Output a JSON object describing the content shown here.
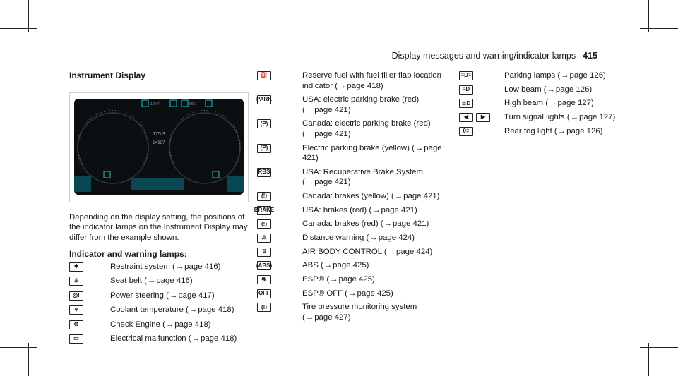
{
  "header": {
    "section": "Display messages and warning/indicator lamps",
    "page_number": "415"
  },
  "left": {
    "heading": "Instrument Display",
    "intro": "Depending on the display setting, the positions of the indicator lamps on the Instrument Display may differ from the example shown.",
    "subheading": "Indicator and warning lamps:",
    "cluster": {
      "top_left": "105°F",
      "top_right": "3:56",
      "center_top": "175.3",
      "center_bottom": "24967"
    },
    "items": [
      {
        "icon": "restraint-system-icon",
        "glyph": "✱",
        "text": "Restraint system (",
        "page": "page 416)"
      },
      {
        "icon": "seat-belt-icon",
        "glyph": "♙",
        "text": "Seat belt (",
        "page": "page 416)"
      },
      {
        "icon": "power-steering-icon",
        "glyph": "◎!",
        "text": "Power steering (",
        "page": "page 417)"
      },
      {
        "icon": "coolant-temperature-icon",
        "glyph": "⫧",
        "text": "Coolant temperature (",
        "page": "page 418)"
      },
      {
        "icon": "check-engine-icon",
        "glyph": "⚙",
        "text": "Check Engine (",
        "page": "page 418)"
      },
      {
        "icon": "battery-icon",
        "glyph": "▭",
        "text": "Electrical malfunction (",
        "page": "page 418)"
      }
    ]
  },
  "middle": {
    "items": [
      {
        "icon": "fuel-icon",
        "glyph": "⛽",
        "text": "Reserve fuel with fuel filler flap location indicator (",
        "page": "page 418)"
      },
      {
        "icon": "park-icon",
        "glyph": "PARK",
        "text": "USA: electric parking brake (red) (",
        "page": "page 421)"
      },
      {
        "icon": "parking-brake-icon",
        "glyph": "(P)",
        "text": "Canada: electric parking brake (red) (",
        "page": "page 421)"
      },
      {
        "icon": "parking-brake-yellow-icon",
        "glyph": "(P)",
        "text": "Electric parking brake (yellow) (",
        "page": "page 421)"
      },
      {
        "icon": "rbs-icon",
        "glyph": "RBS",
        "text": "USA: Recuperative Brake System (",
        "page": "page 421)"
      },
      {
        "icon": "brake-icon",
        "glyph": "(!)",
        "text": "Canada: brakes (yellow) (",
        "page": "page 421)"
      },
      {
        "icon": "brake-usa-icon",
        "glyph": "BRAKE",
        "text": "USA: brakes (red) (",
        "page": "page 421)"
      },
      {
        "icon": "brake-canada-icon",
        "glyph": "(!)",
        "text": "Canada: brakes (red) (",
        "page": "page 421)"
      },
      {
        "icon": "distance-warning-icon",
        "glyph": "⚠",
        "text": "Distance warning (",
        "page": "page 424)"
      },
      {
        "icon": "air-body-control-icon",
        "glyph": "⇅",
        "text": "AIR BODY CONTROL (",
        "page": "page 424)"
      },
      {
        "icon": "abs-icon",
        "glyph": "(ABS)",
        "text": "ABS (",
        "page": "page 425)"
      },
      {
        "icon": "esp-icon",
        "glyph": "⛐",
        "text": "ESP® (",
        "page": "page 425)"
      },
      {
        "icon": "esp-off-icon",
        "glyph": "OFF",
        "text": "ESP® OFF (",
        "page": "page 425)"
      },
      {
        "icon": "tire-pressure-icon",
        "glyph": "(!)",
        "text": "Tire pressure monitoring system (",
        "page": "page 427)"
      }
    ]
  },
  "right": {
    "items": [
      {
        "icon": "parking-lamps-icon",
        "glyph": "≡D≡",
        "text": "Parking lamps (",
        "page": "page 126)"
      },
      {
        "icon": "low-beam-icon",
        "glyph": "≡D",
        "text": "Low beam (",
        "page": "page 126)"
      },
      {
        "icon": "high-beam-icon",
        "glyph": "≣D",
        "text": "High beam (",
        "page": "page 127)"
      },
      {
        "icon": "fog-light-icon",
        "glyph": "0‡",
        "text": "Rear fog light (",
        "page": "page 126)"
      }
    ],
    "turn": {
      "left_glyph": "◀",
      "right_glyph": "▶",
      "text": "Turn signal lights (",
      "page": "page 127)"
    }
  },
  "arrow": "→"
}
